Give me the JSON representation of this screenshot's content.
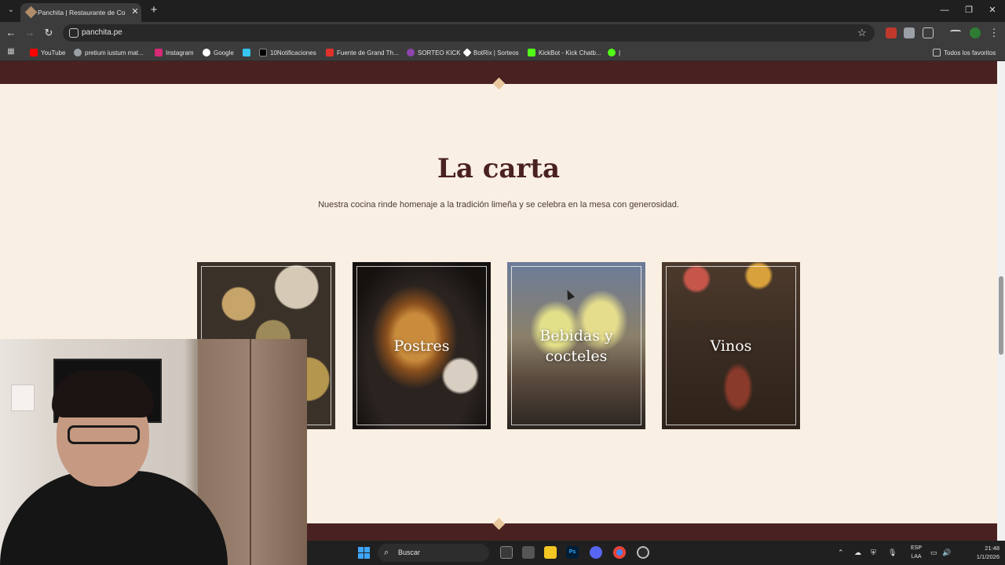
{
  "browser": {
    "tab": {
      "title": "Panchita | Restaurante de Comi"
    },
    "address": {
      "url": "panchita.pe"
    },
    "bookmarks": [
      {
        "label": "YouTube",
        "color": "#ff0000"
      },
      {
        "label": "pretium iustum mat...",
        "color": "#5f6368"
      },
      {
        "label": "Instagram",
        "color": "#d62976"
      },
      {
        "label": "Google",
        "color": "#4285f4"
      },
      {
        "label": "",
        "color": "#34a853"
      },
      {
        "label": "10Notificaciones",
        "color": "#000000"
      },
      {
        "label": "Fuente de Grand Th...",
        "color": "#e0322b"
      },
      {
        "label": "SORTEO KICK",
        "color": "#8e44ad"
      },
      {
        "label": "BotRix | Sorteos",
        "color": "#ffffff"
      },
      {
        "label": "KickBot - Kick Chatb...",
        "color": "#53fc18"
      },
      {
        "label": "|",
        "color": "#53fc18"
      }
    ],
    "bookmarks_all": "Todos los favoritos"
  },
  "page": {
    "section_title": "La carta",
    "section_subtitle": "Nuestra cocina rinde homenaje a la tradición limeña y se celebra en la mesa con generosidad.",
    "cards": [
      {
        "label": "",
        "style": "food"
      },
      {
        "label": "Postres",
        "style": "postres"
      },
      {
        "label": "Bebidas y cocteles",
        "style": "bebidas"
      },
      {
        "label": "Vinos",
        "style": "vinos"
      }
    ]
  },
  "taskbar": {
    "search_placeholder": "Buscar",
    "lang_top": "ESP",
    "lang_bottom": "LAA",
    "time": "21:48",
    "date": "1/1/2026"
  },
  "colors": {
    "brand_dark": "#4a2121",
    "page_bg": "#faefe3",
    "accent": "#e8c89c"
  }
}
